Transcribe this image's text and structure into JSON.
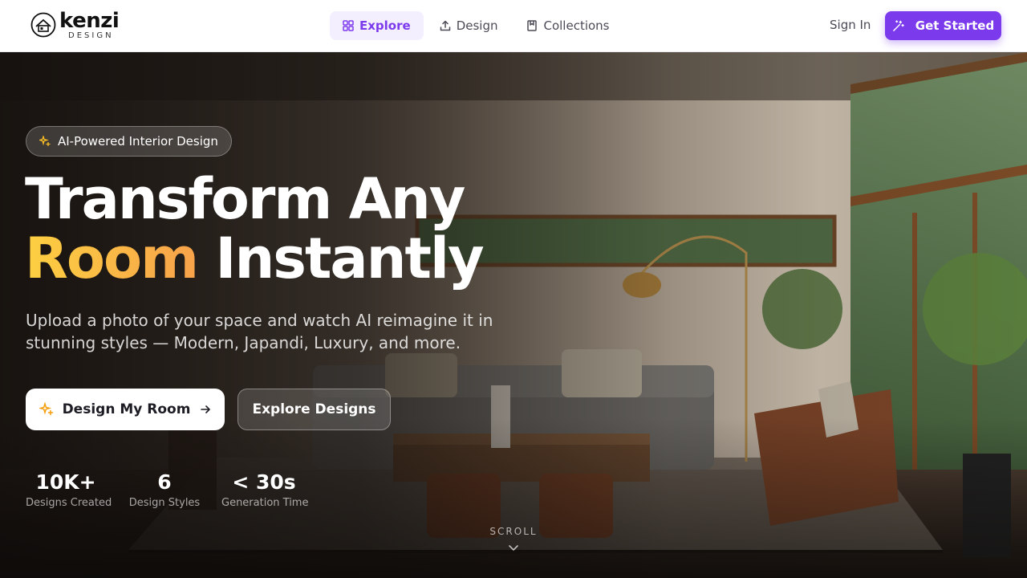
{
  "nav": {
    "logo": {
      "wordmark": "kenzi",
      "subtitle": "DESIGN"
    },
    "tabs": [
      {
        "label": "Explore",
        "icon": "grid-icon",
        "active": true
      },
      {
        "label": "Design",
        "icon": "upload-icon",
        "active": false
      },
      {
        "label": "Collections",
        "icon": "bookmark-icon",
        "active": false
      }
    ],
    "sign_in": "Sign In",
    "get_started": "Get Started"
  },
  "hero": {
    "badge": "AI-Powered Interior Design",
    "headline_line1": "Transform Any",
    "headline_highlight": "Room",
    "headline_line2_rest": "Instantly",
    "subtitle": "Upload a photo of your space and watch AI reimagine it in stunning styles — Modern, Japandi, Luxury, and more.",
    "primary_cta": "Design My Room",
    "secondary_cta": "Explore Designs",
    "stats": [
      {
        "value": "10K+",
        "label": "Designs Created"
      },
      {
        "value": "6",
        "label": "Design Styles"
      },
      {
        "value": "< 30s",
        "label": "Generation Time"
      }
    ],
    "scroll_label": "SCROLL"
  },
  "colors": {
    "accent": "#7c3aed",
    "accent_light": "#f3effe",
    "highlight_start": "#fdd041",
    "highlight_end": "#f7a24a"
  }
}
